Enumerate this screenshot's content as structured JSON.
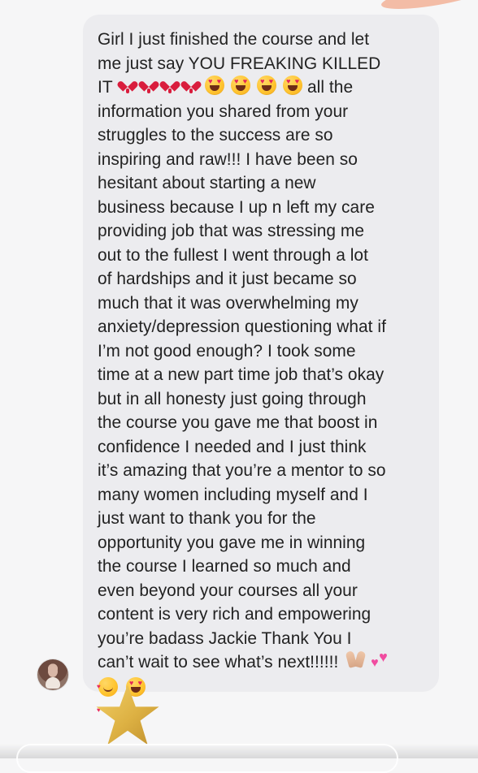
{
  "message": {
    "lines": [
      "Girl I just finished the course and let",
      "me just say YOU FREAKING KILLED",
      "IT",
      "all the",
      "information you shared from your",
      "struggles to the success are so",
      "inspiring and raw!!! I have been so",
      "hesitant about starting a new",
      "business because I up n left my care",
      "providing job that was stressing me",
      "out to the fullest I went through a lot",
      "of hardships and it just became so",
      "much that it was overwhelming my",
      "anxiety/depression questioning what if",
      "I’m not good enough? I took some",
      "time at a new part time job that’s okay",
      "but in all honesty just going through",
      "the course you gave me that boost in",
      "confidence I needed and I just think",
      "it’s amazing that you’re a mentor to so",
      "many women including myself and I",
      "just want to thank you for the",
      "opportunity you gave me in winning",
      "the course I learned so much and",
      "even beyond your courses all your",
      "content is very rich and empowering",
      "you’re badass Jackie Thank You I",
      "can’t wait to see what’s next!!!!!!"
    ]
  },
  "icons": {
    "heart_exclamation": "heart-exclamation-icon",
    "heart_eyes": "heart-eyes-icon",
    "praying_hands": "praying-hands-icon",
    "two_hearts": "two-hearts-icon",
    "smiling_with_hearts": "smiling-with-hearts-icon",
    "star": "star-icon"
  },
  "colors": {
    "background": "#f6f6f7",
    "bubble": "#ececef",
    "text": "#222222",
    "accent": "#e2b63d"
  }
}
